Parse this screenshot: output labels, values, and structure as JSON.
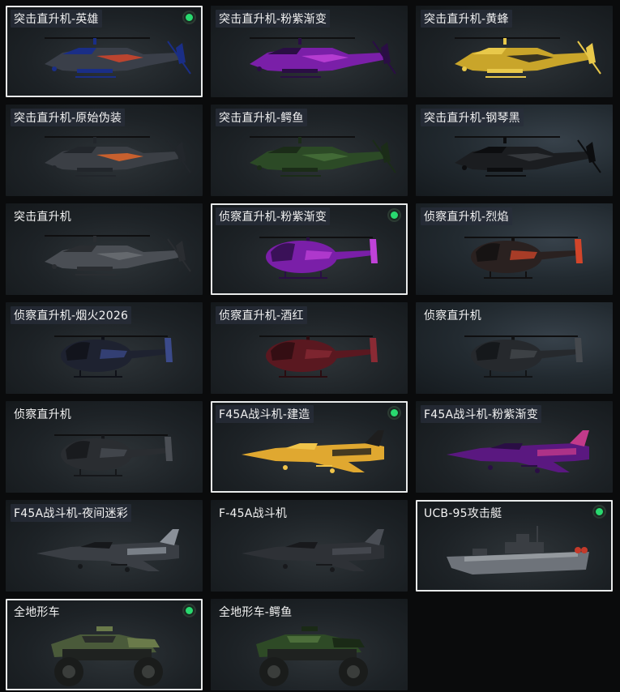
{
  "items": [
    {
      "title": "突击直升机-英雄",
      "selected": true,
      "equipped": true,
      "kind": "attack-heli",
      "colors": [
        "#3a3f49",
        "#d2452a",
        "#1a2e86"
      ]
    },
    {
      "title": "突击直升机-粉紫渐变",
      "selected": false,
      "equipped": false,
      "kind": "attack-heli",
      "colors": [
        "#7a1fa8",
        "#c042d8",
        "#2a0e44"
      ]
    },
    {
      "title": "突击直升机-黄蜂",
      "selected": false,
      "equipped": false,
      "kind": "attack-heli",
      "colors": [
        "#c9a52a",
        "#1e1e1e",
        "#e8c84a"
      ]
    },
    {
      "title": "突击直升机-原始伪装",
      "selected": false,
      "equipped": false,
      "kind": "attack-heli",
      "colors": [
        "#3b3f45",
        "#e0662a",
        "#22262b"
      ]
    },
    {
      "title": "突击直升机-鳄鱼",
      "selected": false,
      "equipped": false,
      "kind": "attack-heli",
      "colors": [
        "#2c4a26",
        "#46703a",
        "#1b2c18"
      ]
    },
    {
      "title": "突击直升机-钢琴黑",
      "selected": false,
      "equipped": false,
      "kind": "attack-heli",
      "colors": [
        "#1b1d20",
        "#3a3d42",
        "#0c0d0f"
      ]
    },
    {
      "title": "突击直升机",
      "selected": false,
      "equipped": false,
      "kind": "attack-heli",
      "colors": [
        "#4a4e54",
        "#6a6e73",
        "#2a2d31"
      ]
    },
    {
      "title": "侦察直升机-粉紫渐变",
      "selected": true,
      "equipped": true,
      "kind": "scout-heli",
      "colors": [
        "#7a1fa8",
        "#c042d8",
        "#2a0e44"
      ]
    },
    {
      "title": "侦察直升机-烈焰",
      "selected": false,
      "equipped": false,
      "kind": "scout-heli",
      "colors": [
        "#2a2120",
        "#d2452a",
        "#121010"
      ]
    },
    {
      "title": "侦察直升机-烟火2026",
      "selected": false,
      "equipped": false,
      "kind": "scout-heli",
      "colors": [
        "#1e2230",
        "#3b4a8a",
        "#0f1118"
      ]
    },
    {
      "title": "侦察直升机-酒红",
      "selected": false,
      "equipped": false,
      "kind": "scout-heli",
      "colors": [
        "#5a1820",
        "#8a2a34",
        "#2a0c10"
      ]
    },
    {
      "title": "侦察直升机",
      "selected": false,
      "equipped": false,
      "kind": "scout-heli",
      "colors": [
        "#26292d",
        "#45494e",
        "#121416"
      ]
    },
    {
      "title": "侦察直升机",
      "selected": false,
      "equipped": false,
      "kind": "scout-heli",
      "colors": [
        "#2a2d31",
        "#4a4e54",
        "#15171a"
      ]
    },
    {
      "title": "F45A战斗机-建造",
      "selected": true,
      "equipped": true,
      "kind": "jet",
      "colors": [
        "#e0a830",
        "#1e1e1e",
        "#f0c44a"
      ]
    },
    {
      "title": "F45A战斗机-粉紫渐变",
      "selected": false,
      "equipped": false,
      "kind": "jet",
      "colors": [
        "#5a1880",
        "#c23a8a",
        "#2a0e44"
      ]
    },
    {
      "title": "F45A战斗机-夜间迷彩",
      "selected": false,
      "equipped": false,
      "kind": "jet",
      "colors": [
        "#3a3e44",
        "#8a9098",
        "#16181b"
      ]
    },
    {
      "title": "F-45A战斗机",
      "selected": false,
      "equipped": false,
      "kind": "jet",
      "colors": [
        "#2e3136",
        "#4a4e55",
        "#18191c"
      ]
    },
    {
      "title": "UCB-95攻击艇",
      "selected": true,
      "equipped": true,
      "kind": "boat",
      "colors": [
        "#6e737a",
        "#a4a9ae",
        "#3a3e43"
      ]
    },
    {
      "title": "全地形车",
      "selected": true,
      "equipped": true,
      "kind": "atv",
      "colors": [
        "#4a5a3a",
        "#2a2d2a",
        "#6a7a4a"
      ]
    },
    {
      "title": "全地形车-鳄鱼",
      "selected": false,
      "equipped": false,
      "kind": "atv",
      "colors": [
        "#2e4a26",
        "#4c6e3a",
        "#1a2a16"
      ]
    }
  ]
}
